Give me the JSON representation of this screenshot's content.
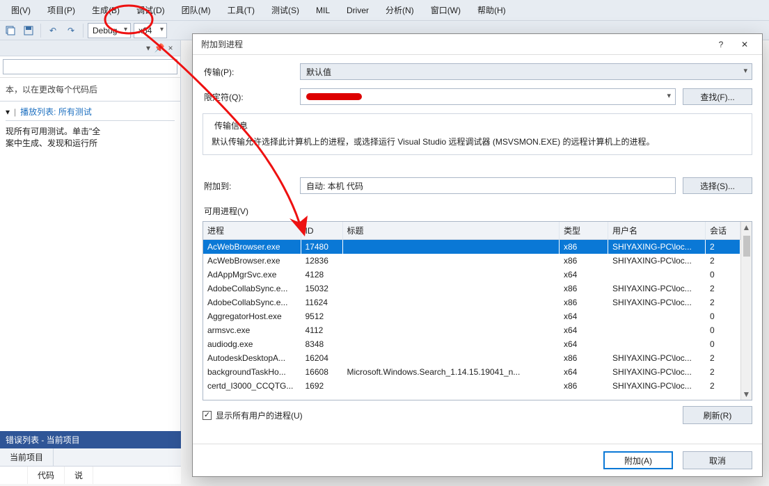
{
  "menu": {
    "view": "图(V)",
    "project": "项目(P)",
    "build": "生成(B)",
    "debug": "调试(D)",
    "team": "团队(M)",
    "tools": "工具(T)",
    "test": "测试(S)",
    "mil": "MIL",
    "driver": "Driver",
    "analyze": "分析(N)",
    "window": "窗口(W)",
    "help": "帮助(H)"
  },
  "toolbar": {
    "config": "Debug",
    "platform": "x64"
  },
  "left": {
    "hint": "本，以在更改每个代码后",
    "playlist": "播放列表: 所有测试",
    "tests_line1": "现所有可用测试。单击\"全",
    "tests_line2": "案中生成、发现和运行所"
  },
  "errlist": {
    "title": "错误列表 - 当前项目",
    "tab": "当前项目",
    "col_code": "代码",
    "col_desc": "说"
  },
  "dialog": {
    "title": "附加到进程",
    "help": "?",
    "transport_lbl": "传输(P):",
    "transport_val": "默认值",
    "qualifier_lbl": "限定符(Q):",
    "find_btn": "查找(F)...",
    "group_title": "传输信息",
    "group_text": "默认传输允许选择此计算机上的进程，或选择运行 Visual Studio 远程调试器 (MSVSMON.EXE) 的远程计算机上的进程。",
    "attachto_lbl": "附加到:",
    "attachto_val": "自动: 本机 代码",
    "select_btn": "选择(S)...",
    "avail_lbl": "可用进程(V)",
    "cols": {
      "proc": "进程",
      "id": "ID",
      "title": "标题",
      "type": "类型",
      "user": "用户名",
      "session": "会话"
    },
    "rows": [
      {
        "proc": "AcWebBrowser.exe",
        "id": "17480",
        "title": "",
        "type": "x86",
        "user": "SHIYAXING-PC\\loc...",
        "session": "2",
        "sel": true
      },
      {
        "proc": "AcWebBrowser.exe",
        "id": "12836",
        "title": "",
        "type": "x86",
        "user": "SHIYAXING-PC\\loc...",
        "session": "2"
      },
      {
        "proc": "AdAppMgrSvc.exe",
        "id": "4128",
        "title": "",
        "type": "x64",
        "user": "",
        "session": "0"
      },
      {
        "proc": "AdobeCollabSync.e...",
        "id": "15032",
        "title": "",
        "type": "x86",
        "user": "SHIYAXING-PC\\loc...",
        "session": "2"
      },
      {
        "proc": "AdobeCollabSync.e...",
        "id": "11624",
        "title": "",
        "type": "x86",
        "user": "SHIYAXING-PC\\loc...",
        "session": "2"
      },
      {
        "proc": "AggregatorHost.exe",
        "id": "9512",
        "title": "",
        "type": "x64",
        "user": "",
        "session": "0"
      },
      {
        "proc": "armsvc.exe",
        "id": "4112",
        "title": "",
        "type": "x64",
        "user": "",
        "session": "0"
      },
      {
        "proc": "audiodg.exe",
        "id": "8348",
        "title": "",
        "type": "x64",
        "user": "",
        "session": "0"
      },
      {
        "proc": "AutodeskDesktopA...",
        "id": "16204",
        "title": "",
        "type": "x86",
        "user": "SHIYAXING-PC\\loc...",
        "session": "2"
      },
      {
        "proc": "backgroundTaskHo...",
        "id": "16608",
        "title": "Microsoft.Windows.Search_1.14.15.19041_n...",
        "type": "x64",
        "user": "SHIYAXING-PC\\loc...",
        "session": "2"
      },
      {
        "proc": "certd_I3000_CCQTG...",
        "id": "1692",
        "title": "",
        "type": "x86",
        "user": "SHIYAXING-PC\\loc...",
        "session": "2"
      }
    ],
    "show_all": "显示所有用户的进程(U)",
    "refresh": "刷新(R)",
    "attach": "附加(A)",
    "cancel": "取消"
  }
}
